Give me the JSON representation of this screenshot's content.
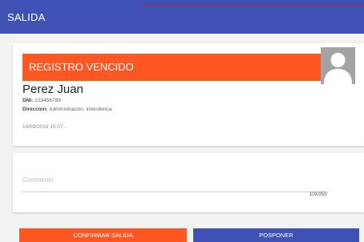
{
  "header": {
    "title": "SALIDA"
  },
  "record": {
    "status": "REGISTRO VENCIDO",
    "name": "Perez Juan",
    "dni_label": "DNI:",
    "dni_value": "123456789",
    "address_label": "Direccion:",
    "address_value": "Administracion, intendenca",
    "timestamp": "14/09/2018 15:07 -"
  },
  "comments": {
    "placeholder": "Comments",
    "value": "",
    "counter": "101/250"
  },
  "actions": {
    "confirm_label": "CONFIRMAR SALIDA",
    "postpone_label": "POSPONER"
  },
  "colors": {
    "primary": "#3f51b5",
    "accent": "#ff5722",
    "avatar": "#a3a3a3"
  },
  "icons": {
    "avatar": "person-silhouette-icon"
  }
}
